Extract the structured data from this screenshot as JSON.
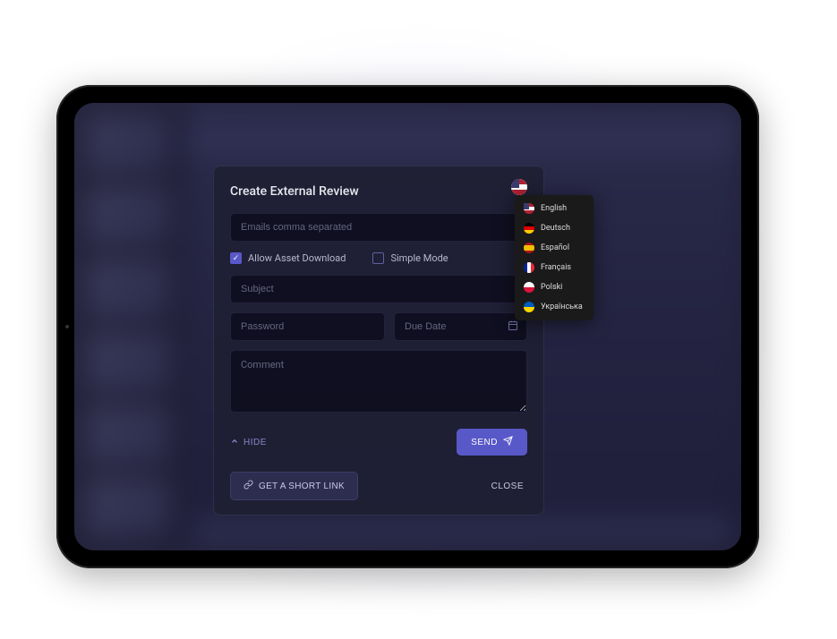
{
  "modal": {
    "title": "Create External Review",
    "emails_placeholder": "Emails comma separated",
    "allow_download_label": "Allow Asset Download",
    "allow_download_checked": true,
    "simple_mode_label": "Simple Mode",
    "simple_mode_checked": false,
    "subject_placeholder": "Subject",
    "password_placeholder": "Password",
    "due_date_placeholder": "Due Date",
    "comment_placeholder": "Comment",
    "hide_label": "HIDE",
    "send_label": "SEND",
    "short_link_label": "GET A SHORT LINK",
    "close_label": "CLOSE"
  },
  "language": {
    "selected": "English",
    "options": [
      {
        "label": "English",
        "flag": "us"
      },
      {
        "label": "Deutsch",
        "flag": "de"
      },
      {
        "label": "Español",
        "flag": "es"
      },
      {
        "label": "Français",
        "flag": "fr"
      },
      {
        "label": "Polski",
        "flag": "pl"
      },
      {
        "label": "Українська",
        "flag": "ua"
      }
    ]
  }
}
